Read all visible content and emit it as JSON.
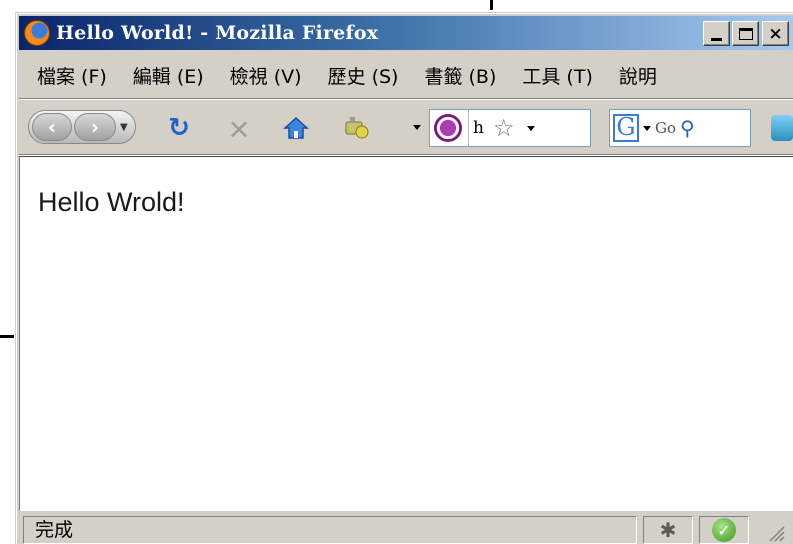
{
  "window": {
    "title": "Hello World! - Mozilla Firefox",
    "app_icon": "firefox-icon",
    "controls": [
      "minimize-icon",
      "maximize-icon",
      "close-icon"
    ],
    "close_label": "×"
  },
  "menubar": {
    "items": [
      {
        "label": "檔案 (F)"
      },
      {
        "label": "編輯 (E)"
      },
      {
        "label": "檢視 (V)"
      },
      {
        "label": "歷史 (S)"
      },
      {
        "label": "書籤 (B)"
      },
      {
        "label": "工具 (T)"
      },
      {
        "label": "說明"
      }
    ]
  },
  "navbar": {
    "back_glyph": "‹",
    "forward_glyph": "›",
    "reload_glyph": "↻",
    "stop_glyph": "×",
    "url_text": "h",
    "star_glyph": "☆",
    "search_engine_glyph": "G",
    "search_placeholder": "Go",
    "search_glyph": "⚲",
    "icons": [
      "back-icon",
      "forward-icon",
      "reload-icon",
      "stop-icon",
      "home-icon",
      "addon-icon",
      "site-identity-icon",
      "bookmark-star-icon",
      "google-icon",
      "search-icon"
    ]
  },
  "content": {
    "text": "Hello Wrold!"
  },
  "statusbar": {
    "status_text": "完成",
    "bug_glyph": "✱",
    "ok_glyph": "✓"
  },
  "colors": {
    "titlebar_start": "#0a246a",
    "titlebar_end": "#a6caf0",
    "chrome": "#d4d0c8",
    "page_bg": "#ffffff"
  }
}
